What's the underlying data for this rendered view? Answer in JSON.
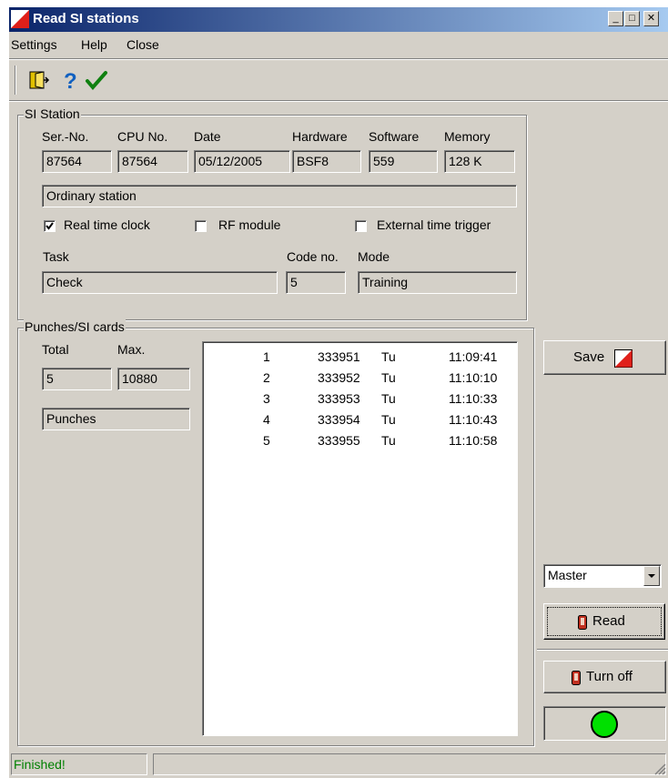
{
  "window": {
    "title": "Read SI stations",
    "minimize_label": "_",
    "maximize_label": "□",
    "close_label": "✕"
  },
  "menu": {
    "items": [
      "Settings",
      "Help",
      "Close"
    ]
  },
  "toolbar": {
    "icons": [
      "exit-door-icon",
      "help-question-icon",
      "checkmark-icon"
    ]
  },
  "si_station": {
    "group_title": "SI Station",
    "labels": {
      "serial": "Ser.-No.",
      "cpu": "CPU No.",
      "date": "Date",
      "hardware": "Hardware",
      "software": "Software",
      "memory": "Memory"
    },
    "values": {
      "serial": "87564",
      "cpu": "87564",
      "date": "05/12/2005",
      "hardware": "BSF8",
      "software": "559",
      "memory": "128 K"
    },
    "station_type": "Ordinary station",
    "checkboxes": {
      "real_time_clock": {
        "label": "Real time clock",
        "checked": true
      },
      "rf_module": {
        "label": "RF module",
        "checked": false
      },
      "external_trigger": {
        "label": "External time trigger",
        "checked": false
      }
    },
    "task_label": "Task",
    "task_value": "Check",
    "code_label": "Code no.",
    "code_value": "5",
    "mode_label": "Mode",
    "mode_value": "Training"
  },
  "punches": {
    "group_title": "Punches/SI cards",
    "total_label": "Total",
    "max_label": "Max.",
    "total_value": "5",
    "max_value": "10880",
    "type_value": "Punches",
    "rows": [
      {
        "no": "1",
        "code": "333951",
        "day": "Tu",
        "time": "11:09:41"
      },
      {
        "no": "2",
        "code": "333952",
        "day": "Tu",
        "time": "11:10:10"
      },
      {
        "no": "3",
        "code": "333953",
        "day": "Tu",
        "time": "11:10:33"
      },
      {
        "no": "4",
        "code": "333954",
        "day": "Tu",
        "time": "11:10:43"
      },
      {
        "no": "5",
        "code": "333955",
        "day": "Tu",
        "time": "11:10:58"
      }
    ]
  },
  "buttons": {
    "save": "Save",
    "read": "Read",
    "turn_off": "Turn off"
  },
  "master_select": {
    "value": "Master"
  },
  "status": {
    "text": "Finished!",
    "indicator_color": "#00e000"
  },
  "colors": {
    "window_bg": "#d4d0c8",
    "title_start": "#0a246a",
    "title_end": "#a6caf0",
    "status_text": "#008000"
  }
}
